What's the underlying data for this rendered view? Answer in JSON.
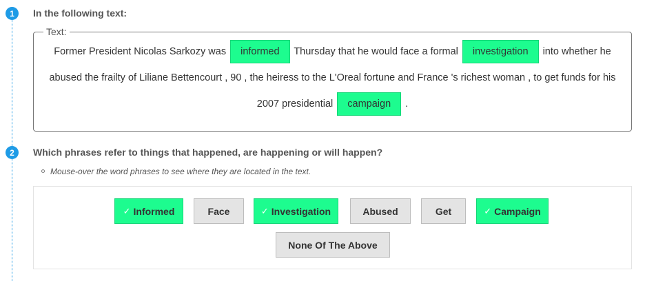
{
  "step1": {
    "number": "1",
    "title": "In the following text:"
  },
  "textbox": {
    "legend": "Text:",
    "segments": [
      "Former President Nicolas Sarkozy was",
      "informed",
      "Thursday that he would face a formal",
      "investigation",
      "into whether he abused the frailty of Liliane Bettencourt , 90 , the heiress to the L'Oreal fortune and France 's richest woman , to get funds for his 2007 presidential",
      "campaign",
      "."
    ]
  },
  "step2": {
    "number": "2",
    "title": "Which phrases refer to things that happened, are happening or will happen?",
    "note": "Mouse-over the word phrases to see where they are located in the text."
  },
  "options": [
    {
      "label": "Informed",
      "selected": true
    },
    {
      "label": "Face",
      "selected": false
    },
    {
      "label": "Investigation",
      "selected": true
    },
    {
      "label": "Abused",
      "selected": false
    },
    {
      "label": "Get",
      "selected": false
    },
    {
      "label": "Campaign",
      "selected": true
    },
    {
      "label": "None Of The Above",
      "selected": false
    }
  ],
  "colors": {
    "accent": "#1e9be6",
    "highlight": "#1dfc8f"
  },
  "icons": {
    "selected": "check-icon",
    "note": "bullet-icon"
  }
}
